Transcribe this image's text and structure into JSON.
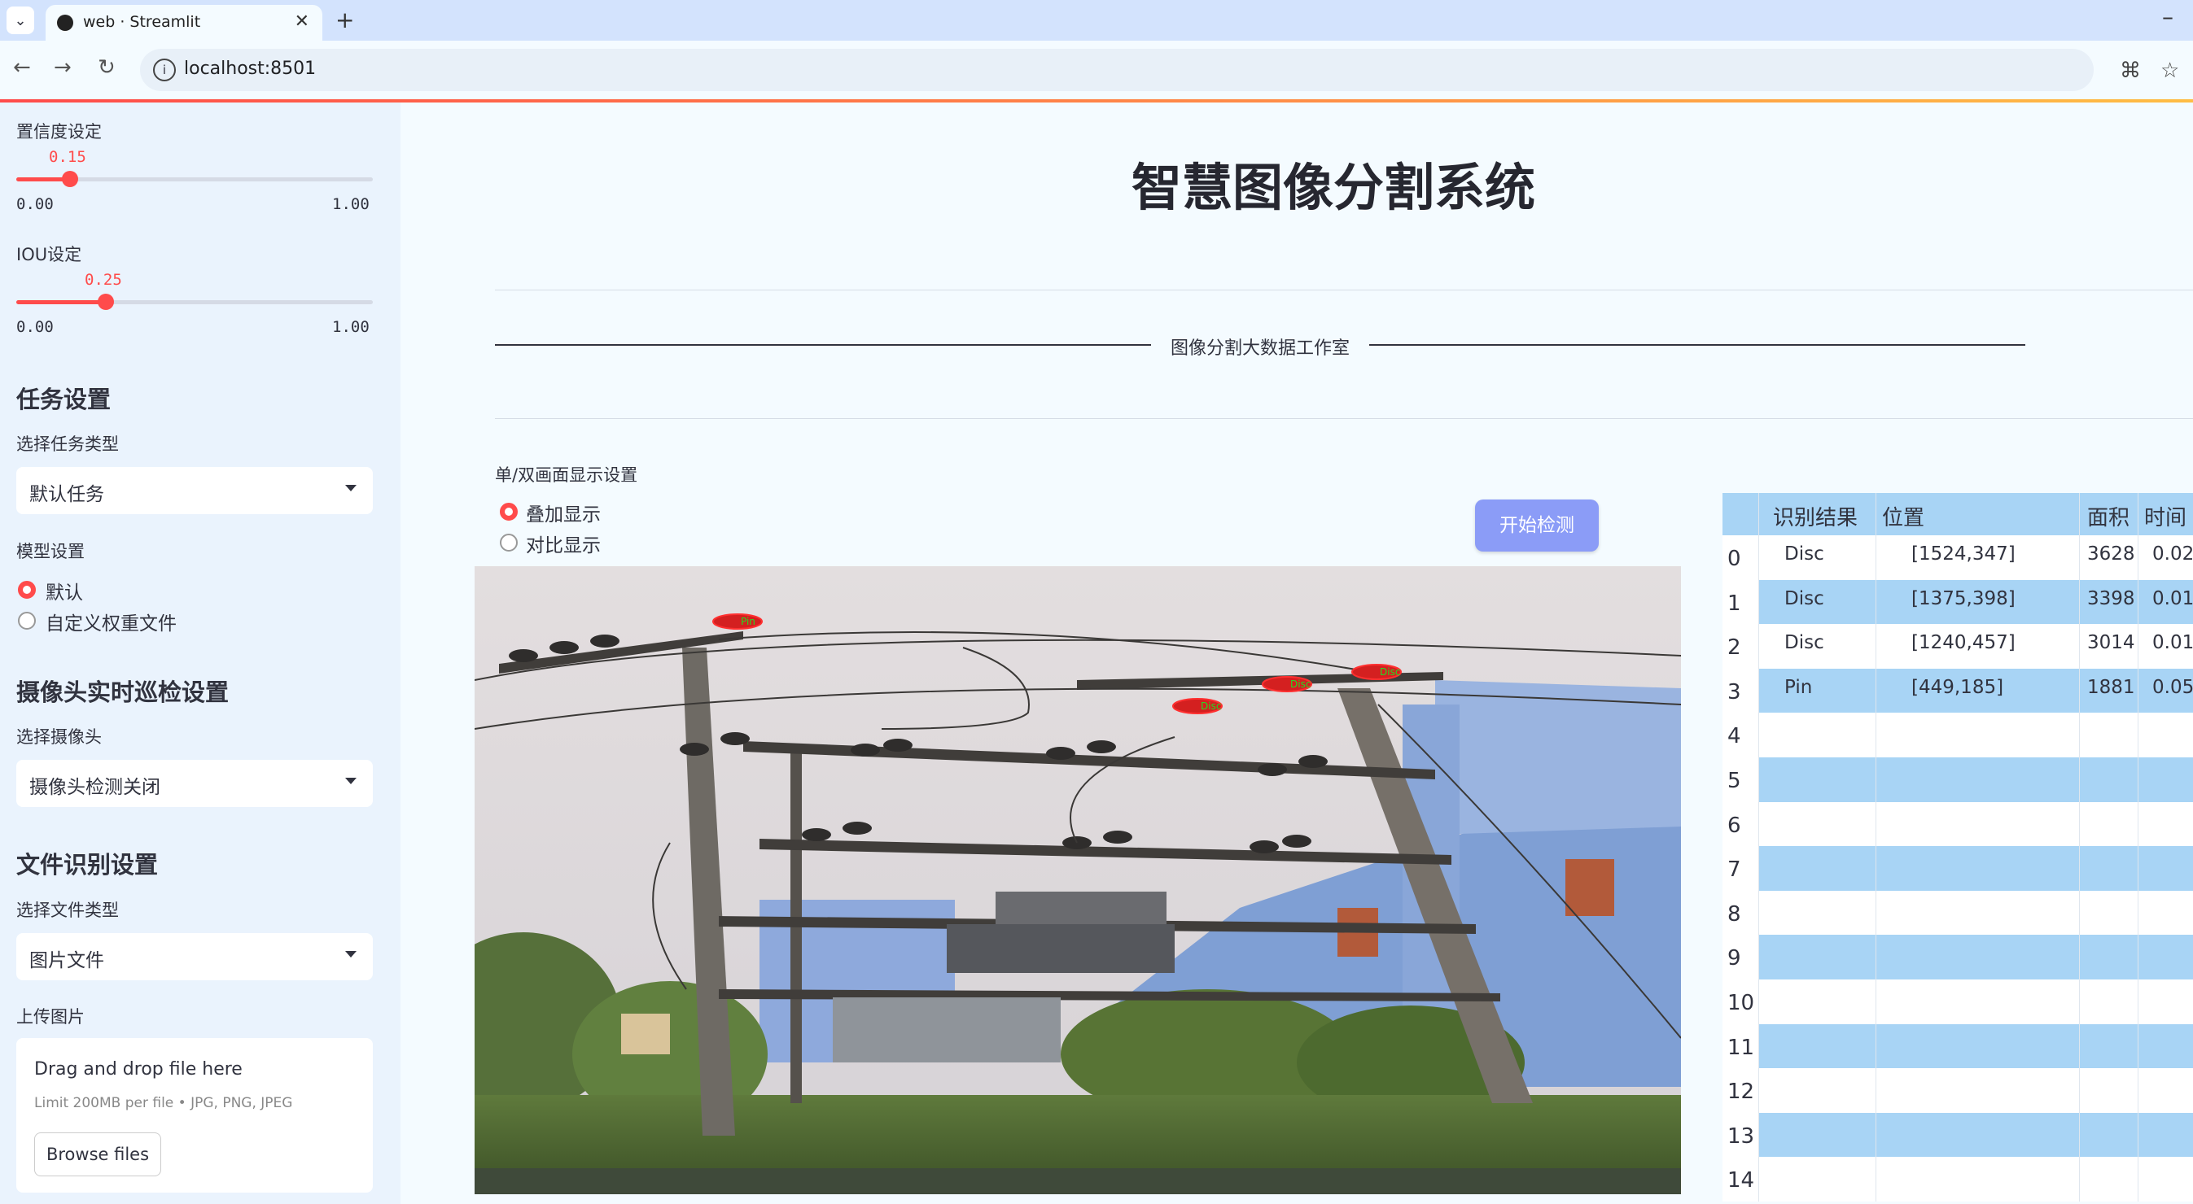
{
  "browser": {
    "tab_title": "web · Streamlit",
    "url": "localhost:8501"
  },
  "sidebar": {
    "confidence": {
      "label": "置信度设定",
      "value": 0.15,
      "value_text": "0.15",
      "min": "0.00",
      "max": "1.00"
    },
    "iou": {
      "label": "IOU设定",
      "value": 0.25,
      "value_text": "0.25",
      "min": "0.00",
      "max": "1.00"
    },
    "task_section": "任务设置",
    "task_type_label": "选择任务类型",
    "task_type_value": "默认任务",
    "model_label": "模型设置",
    "model_options": [
      "默认",
      "自定义权重文件"
    ],
    "model_selected": "默认",
    "camera_section": "摄像头实时巡检设置",
    "camera_label": "选择摄像头",
    "camera_value": "摄像头检测关闭",
    "file_section": "文件识别设置",
    "file_type_label": "选择文件类型",
    "file_type_value": "图片文件",
    "upload_label": "上传图片",
    "upload_drag": "Drag and drop file here",
    "upload_limit": "Limit 200MB per file • JPG, PNG, JPEG",
    "upload_button": "Browse files"
  },
  "main": {
    "title": "智慧图像分割系统",
    "studio": "图像分割大数据工作室",
    "display_label": "单/双画面显示设置",
    "display_options": [
      "叠加显示",
      "对比显示"
    ],
    "display_selected": "叠加显示",
    "start_button": "开始检测",
    "detections": [
      "Pin",
      "Disc",
      "Disc",
      "Disc"
    ]
  },
  "table": {
    "columns": [
      "识别结果",
      "位置",
      "面积",
      "时间"
    ],
    "rows": [
      {
        "index": "0",
        "result": "Disc",
        "position": "[1524,347]",
        "area": "3628",
        "time": "0.02"
      },
      {
        "index": "1",
        "result": "Disc",
        "position": "[1375,398]",
        "area": "3398",
        "time": "0.01"
      },
      {
        "index": "2",
        "result": "Disc",
        "position": "[1240,457]",
        "area": "3014",
        "time": "0.01"
      },
      {
        "index": "3",
        "result": "Pin",
        "position": "[449,185]",
        "area": "1881",
        "time": "0.05"
      },
      {
        "index": "4",
        "result": "",
        "position": "",
        "area": "",
        "time": ""
      },
      {
        "index": "5",
        "result": "",
        "position": "",
        "area": "",
        "time": ""
      },
      {
        "index": "6",
        "result": "",
        "position": "",
        "area": "",
        "time": ""
      },
      {
        "index": "7",
        "result": "",
        "position": "",
        "area": "",
        "time": ""
      },
      {
        "index": "8",
        "result": "",
        "position": "",
        "area": "",
        "time": ""
      },
      {
        "index": "9",
        "result": "",
        "position": "",
        "area": "",
        "time": ""
      },
      {
        "index": "10",
        "result": "",
        "position": "",
        "area": "",
        "time": ""
      },
      {
        "index": "11",
        "result": "",
        "position": "",
        "area": "",
        "time": ""
      },
      {
        "index": "12",
        "result": "",
        "position": "",
        "area": "",
        "time": ""
      },
      {
        "index": "13",
        "result": "",
        "position": "",
        "area": "",
        "time": ""
      },
      {
        "index": "14",
        "result": "",
        "position": "",
        "area": "",
        "time": ""
      }
    ]
  },
  "colors": {
    "accent": "#ff4b4b",
    "button": "#8b9cf7",
    "table_header": "#a8d4f5",
    "sidebar": "#eaf3fd"
  }
}
